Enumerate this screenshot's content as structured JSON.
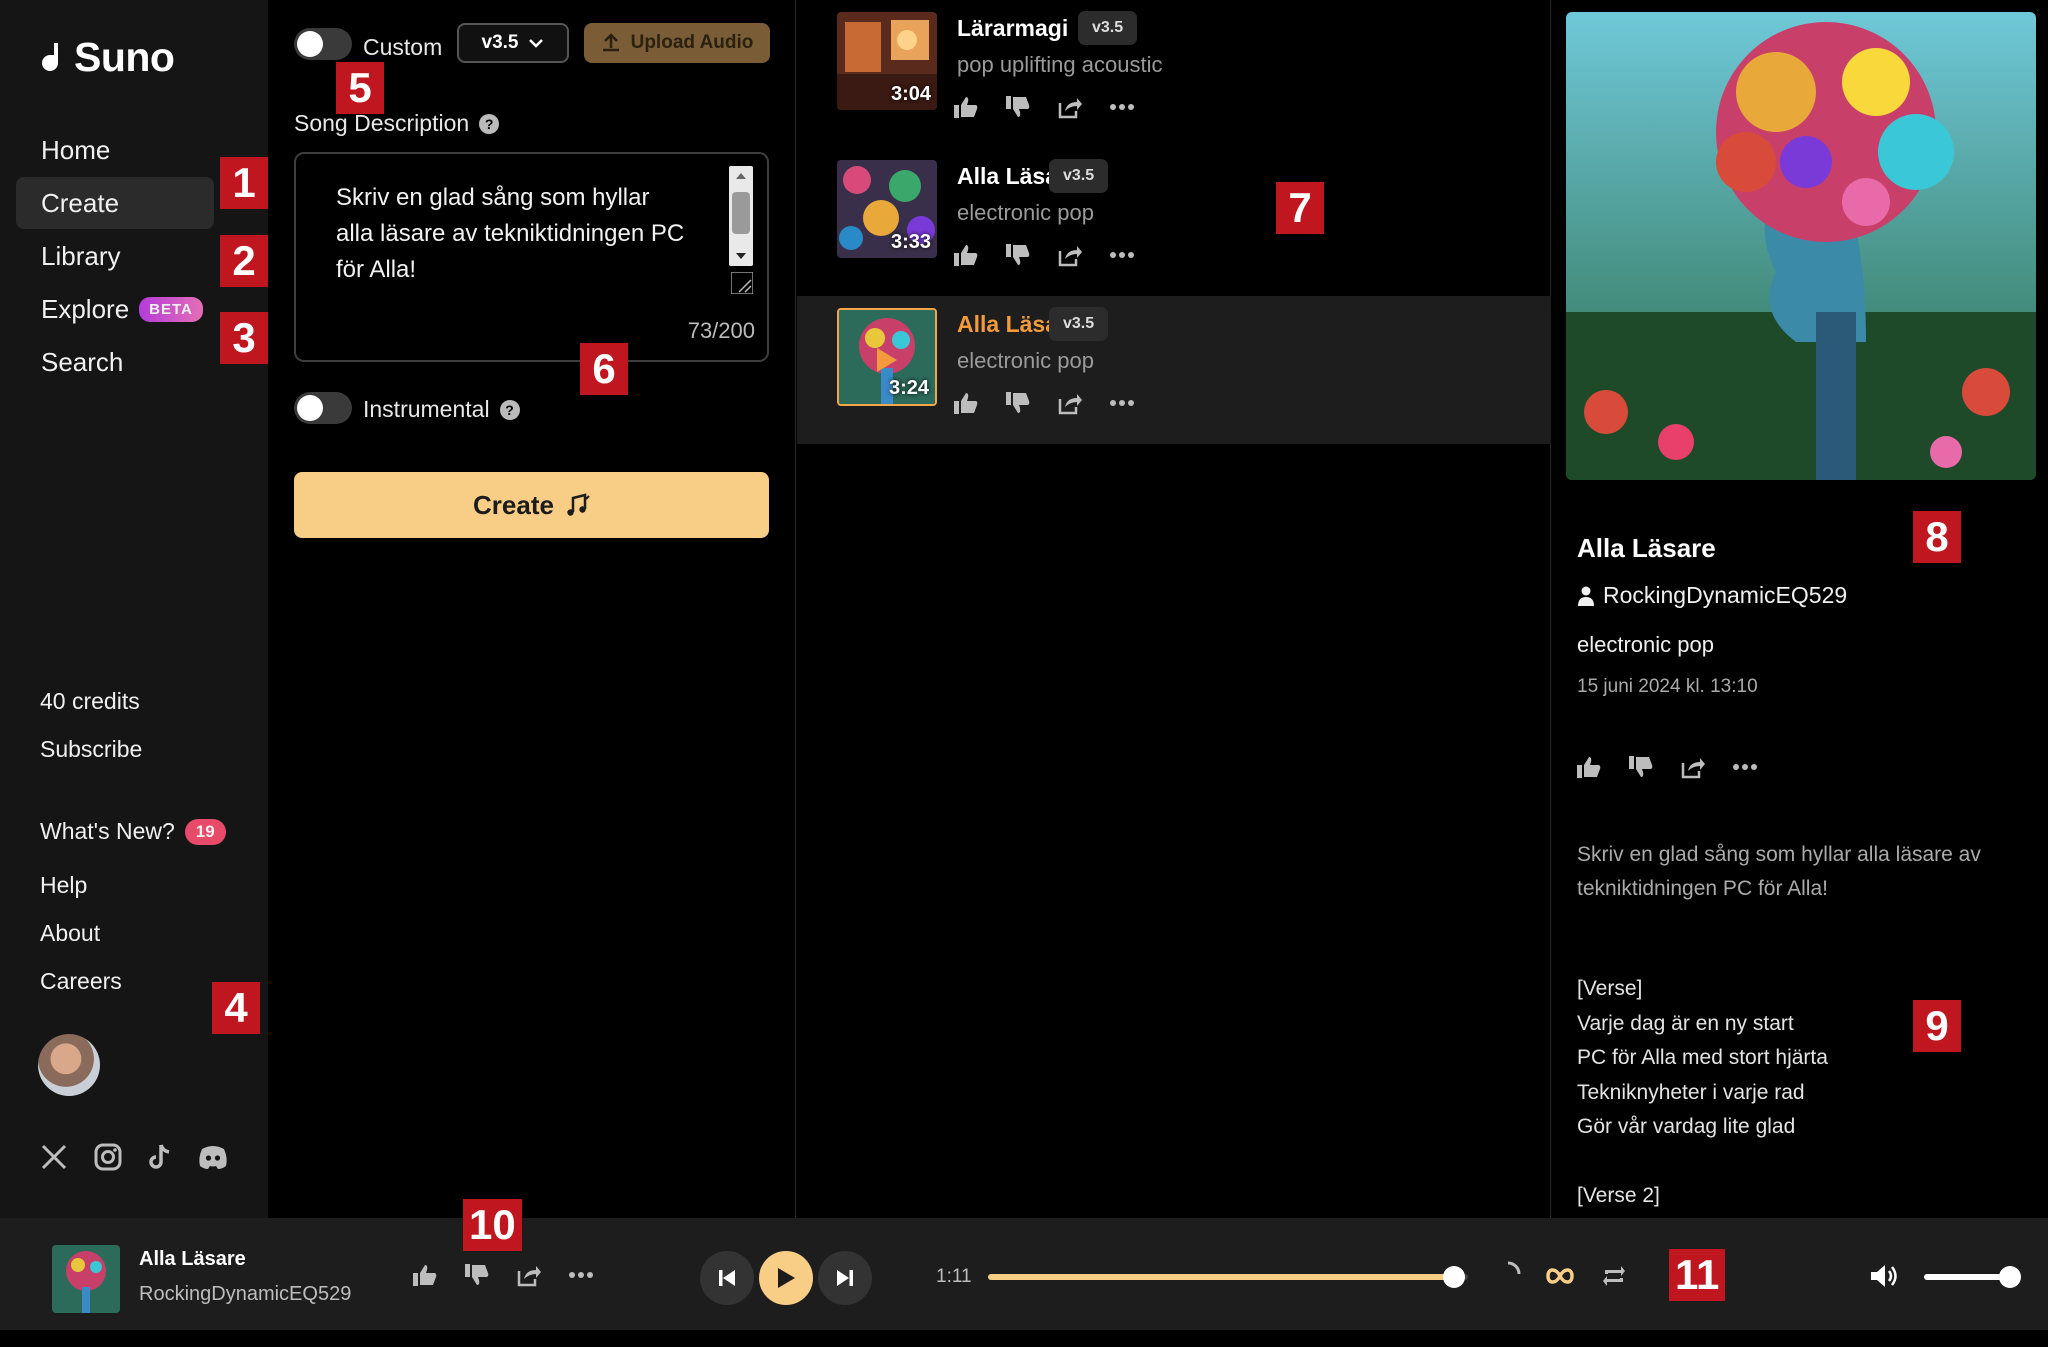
{
  "app": {
    "name": "Suno"
  },
  "nav": {
    "items": [
      {
        "label": "Home"
      },
      {
        "label": "Create"
      },
      {
        "label": "Library"
      },
      {
        "label": "Explore",
        "badge": "BETA"
      },
      {
        "label": "Search"
      }
    ]
  },
  "sidebar": {
    "credits": "40 credits",
    "subscribe": "Subscribe",
    "whats_new": "What's New?",
    "whats_new_count": "19",
    "help": "Help",
    "about": "About",
    "careers": "Careers",
    "socials": [
      "x-icon",
      "instagram-icon",
      "tiktok-icon",
      "discord-icon"
    ]
  },
  "create": {
    "custom_label": "Custom",
    "model_version": "v3.5",
    "upload_label": "Upload Audio",
    "description_label": "Song Description",
    "description_text": "Skriv en glad sång som hyllar alla läsare av tekniktidningen PC för Alla!",
    "char_count": "73/200",
    "instrumental_label": "Instrumental",
    "create_label": "Create"
  },
  "songs": [
    {
      "title": "Lärarmagi",
      "version": "v3.5",
      "style": "pop uplifting acoustic",
      "duration": "3:04"
    },
    {
      "title": "Alla Läsare",
      "version": "v3.5",
      "style": "electronic pop",
      "duration": "3:33"
    },
    {
      "title": "Alla Läsare",
      "version": "v3.5",
      "style": "electronic pop",
      "duration": "3:24"
    }
  ],
  "detail": {
    "title": "Alla Läsare",
    "user": "RockingDynamicEQ529",
    "style": "electronic pop",
    "date": "15 juni 2024 kl. 13:10",
    "description": "Skriv en glad sång som hyllar alla läsare av tekniktidningen PC för Alla!",
    "lyrics": [
      "[Verse]",
      "Varje dag är en ny start",
      "PC för Alla med stort hjärta",
      "Tekniknyheter i varje rad",
      "Gör vår vardag lite glad",
      "",
      "[Verse 2]"
    ]
  },
  "player": {
    "title": "Alla Läsare",
    "user": "RockingDynamicEQ529",
    "elapsed": "1:11",
    "progress": 0.97,
    "volume": 0.95
  },
  "markers": [
    "1",
    "2",
    "3",
    "4",
    "5",
    "6",
    "7",
    "8",
    "9",
    "10",
    "11"
  ],
  "colors": {
    "accent": "#f8cd85",
    "active_title": "#f39a3c",
    "marker": "#c0161f",
    "beta_badge": "#b43cd9"
  }
}
